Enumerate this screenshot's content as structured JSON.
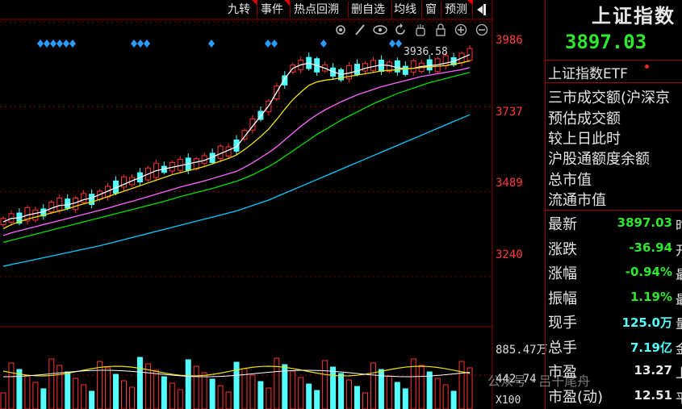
{
  "toolbar": {
    "items": [
      "九转",
      "事件",
      "热点回溯",
      "删自选",
      "均线",
      "窗",
      "预测"
    ],
    "exit_icon": "exit-icon",
    "tool_icons": [
      "settings-icon",
      "pen-icon",
      "eye-icon",
      "hand-icon",
      "lock-icon",
      "zoom-in-icon",
      "zoom-out-icon"
    ]
  },
  "axis": {
    "y_labels": [
      "3986",
      "3737",
      "3489",
      "3240"
    ],
    "high_label": "3936.58",
    "volume_max": "885.47万",
    "volume_mid": "442.74",
    "volume_unit": "X100"
  },
  "colors": {
    "up": "#ff3232",
    "down": "#54ffff",
    "ma5": "#ffffff",
    "ma10": "#f0e000",
    "ma20": "#ff66ff",
    "ma30": "#00e000",
    "ma60": "#00ccff",
    "grid": "#8b0000",
    "diamond": "#2a9dff"
  },
  "chart_data": {
    "type": "candlestick",
    "title": "",
    "ylim": [
      3100,
      4050
    ],
    "y_ticks": [
      3986,
      3737,
      3489,
      3240
    ],
    "volume_label": "885.47万",
    "high_marker": 3936.58,
    "series": [
      {
        "values": [
          3400,
          3410,
          3412,
          3420,
          3425,
          3430,
          3440,
          3448,
          3450,
          3456,
          3465,
          3470,
          3480,
          3490,
          3500,
          3510,
          3520,
          3530,
          3540,
          3550,
          3555,
          3560,
          3565,
          3570,
          3575,
          3580,
          3590,
          3600,
          3610,
          3620,
          3650,
          3680,
          3710,
          3740,
          3780,
          3820,
          3850,
          3860,
          3865,
          3858,
          3850,
          3840,
          3832,
          3836,
          3842,
          3850,
          3855,
          3860,
          3858,
          3852,
          3848,
          3850,
          3855,
          3858,
          3860,
          3865,
          3870,
          3880,
          3890
        ]
      },
      {
        "values": [
          3380,
          3392,
          3400,
          3408,
          3414,
          3420,
          3426,
          3432,
          3438,
          3446,
          3453,
          3458,
          3466,
          3474,
          3482,
          3490,
          3498,
          3506,
          3514,
          3522,
          3530,
          3538,
          3544,
          3550,
          3556,
          3562,
          3570,
          3578,
          3586,
          3596,
          3612,
          3630,
          3650,
          3672,
          3700,
          3730,
          3758,
          3780,
          3800,
          3810,
          3815,
          3818,
          3822,
          3826,
          3830,
          3834,
          3838,
          3842,
          3844,
          3846,
          3848,
          3850,
          3852,
          3854,
          3856,
          3858,
          3862,
          3866,
          3872
        ]
      },
      {
        "values": [
          3360,
          3368,
          3374,
          3380,
          3386,
          3392,
          3398,
          3404,
          3410,
          3416,
          3422,
          3428,
          3434,
          3440,
          3447,
          3454,
          3460,
          3467,
          3474,
          3481,
          3488,
          3495,
          3502,
          3508,
          3514,
          3520,
          3527,
          3534,
          3541,
          3548,
          3560,
          3573,
          3588,
          3603,
          3620,
          3640,
          3660,
          3680,
          3698,
          3714,
          3728,
          3740,
          3752,
          3762,
          3772,
          3780,
          3788,
          3796,
          3802,
          3808,
          3814,
          3820,
          3826,
          3830,
          3834,
          3838,
          3842,
          3846,
          3852
        ]
      },
      {
        "values": [
          3340,
          3346,
          3352,
          3358,
          3364,
          3370,
          3376,
          3382,
          3388,
          3394,
          3400,
          3406,
          3412,
          3418,
          3424,
          3430,
          3436,
          3442,
          3448,
          3454,
          3460,
          3467,
          3474,
          3480,
          3486,
          3492,
          3498,
          3505,
          3512,
          3519,
          3528,
          3538,
          3550,
          3562,
          3576,
          3592,
          3608,
          3624,
          3640,
          3656,
          3670,
          3684,
          3698,
          3710,
          3722,
          3734,
          3746,
          3756,
          3766,
          3776,
          3784,
          3792,
          3800,
          3808,
          3814,
          3820,
          3826,
          3832,
          3838
        ]
      },
      {
        "values": [
          3270,
          3275,
          3280,
          3285,
          3290,
          3295,
          3300,
          3305,
          3310,
          3315,
          3320,
          3325,
          3330,
          3336,
          3342,
          3348,
          3354,
          3360,
          3366,
          3372,
          3378,
          3384,
          3390,
          3396,
          3402,
          3408,
          3414,
          3420,
          3426,
          3432,
          3440,
          3448,
          3456,
          3464,
          3474,
          3484,
          3494,
          3504,
          3514,
          3524,
          3534,
          3544,
          3554,
          3564,
          3574,
          3584,
          3594,
          3604,
          3614,
          3624,
          3634,
          3644,
          3654,
          3664,
          3674,
          3684,
          3694,
          3704,
          3714
        ]
      }
    ]
  },
  "right_panel": {
    "title": "上证指数",
    "price": "3897.03",
    "etf": "上证指数ETF",
    "rows": [
      "三市成交额(沪深京",
      "预估成交额",
      "较上日此时",
      "沪股通额度余额",
      "总市值",
      "流通市值"
    ],
    "stats": [
      {
        "label": "最新",
        "value": "3897.03",
        "color": "#2ee82e",
        "suffix": "时"
      },
      {
        "label": "涨跌",
        "value": "-36.94",
        "color": "#2ee82e",
        "suffix": "开"
      },
      {
        "label": "涨幅",
        "value": "-0.94%",
        "color": "#2ee82e",
        "suffix": "最"
      },
      {
        "label": "振幅",
        "value": "1.19%",
        "color": "#2ee82e",
        "suffix": "最"
      },
      {
        "label": "现手",
        "value": "125.0万",
        "color": "#54ffff",
        "suffix": "量"
      },
      {
        "label": "总手",
        "value": "7.19亿",
        "color": "#54ffff",
        "suffix": "金"
      },
      {
        "label": "市盈",
        "value": "13.27",
        "color": "#e6e6e6",
        "suffix": "上"
      },
      {
        "label": "市盈(动)",
        "value": "12.51",
        "color": "#e6e6e6",
        "suffix": "平"
      }
    ]
  },
  "watermark": "公众号 · 吕干尾舟"
}
